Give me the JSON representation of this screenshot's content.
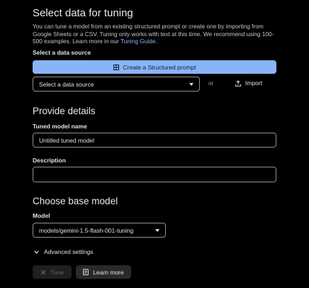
{
  "select_data": {
    "heading": "Select data for tuning",
    "description_prefix": "You can tune a model from an existing structured prompt or create one by importing from Google Sheets or a CSV. Tuning only works with text at this time. We recommend using 100-500 examples. Learn more in our ",
    "description_link": "Tuning Guide",
    "description_suffix": ".",
    "source_label": "Select a data source",
    "create_button": "Create a Structured prompt",
    "source_dropdown": "Select a data source",
    "or_text": "or",
    "import_button": "Import"
  },
  "details": {
    "heading": "Provide details",
    "model_name_label": "Tuned model name",
    "model_name_value": "Untitled tuned model",
    "description_label": "Description",
    "description_value": ""
  },
  "base_model": {
    "heading": "Choose base model",
    "model_label": "Model",
    "model_value": "models/gemini-1.5-flash-001-tuning",
    "advanced_settings": "Advanced settings"
  },
  "actions": {
    "tune": "Tune",
    "learn_more": "Learn more"
  }
}
